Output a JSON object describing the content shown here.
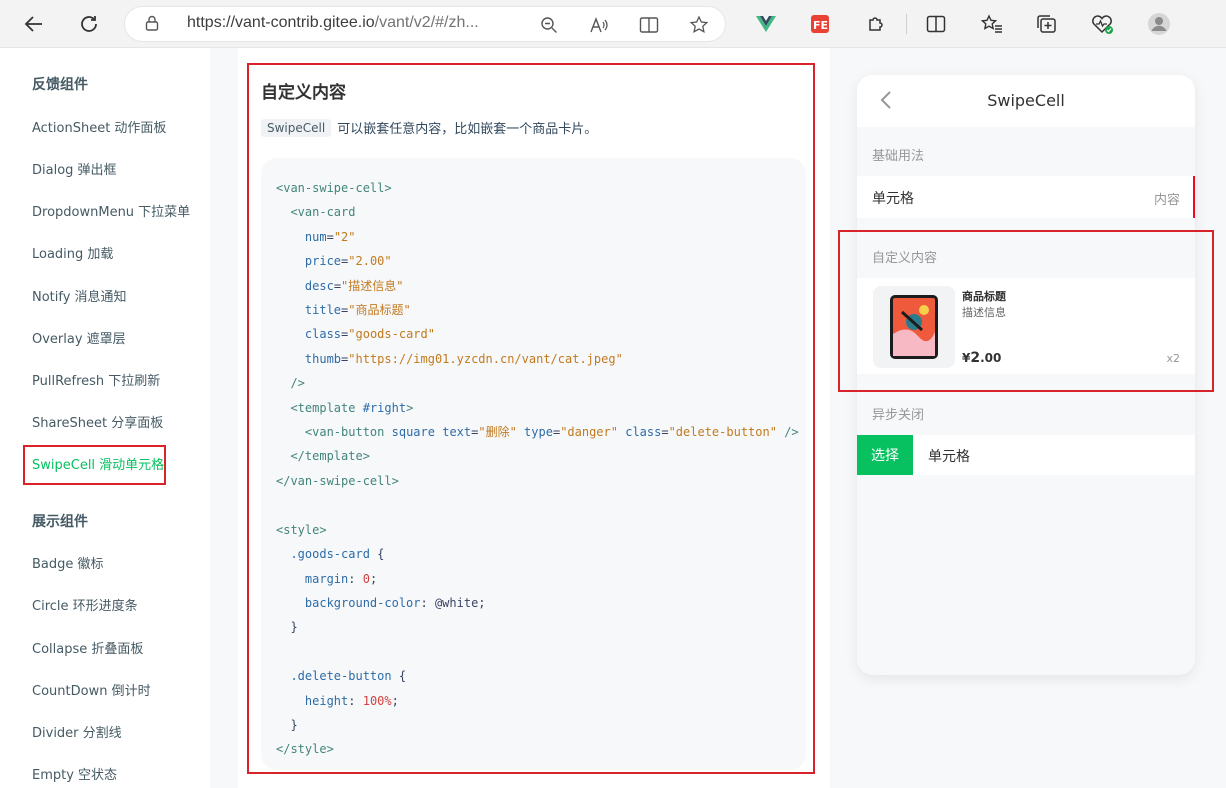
{
  "browser": {
    "url_host": "https://vant-contrib.gitee.io",
    "url_path": "/vant/v2/#/zh..."
  },
  "sidebar": {
    "groups": [
      {
        "title": "反馈组件",
        "items": [
          "ActionSheet 动作面板",
          "Dialog 弹出框",
          "DropdownMenu 下拉菜单",
          "Loading 加载",
          "Notify 消息通知",
          "Overlay 遮罩层",
          "PullRefresh 下拉刷新",
          "ShareSheet 分享面板",
          "SwipeCell 滑动单元格"
        ]
      },
      {
        "title": "展示组件",
        "items": [
          "Badge 徽标",
          "Circle 环形进度条",
          "Collapse 折叠面板",
          "CountDown 倒计时",
          "Divider 分割线",
          "Empty 空状态"
        ]
      }
    ],
    "active": "SwipeCell 滑动单元格"
  },
  "doc": {
    "title": "自定义内容",
    "desc_code": "SwipeCell",
    "desc_text": "可以嵌套任意内容，比如嵌套一个商品卡片。"
  },
  "phone": {
    "title": "SwipeCell",
    "sections": {
      "basic": "基础用法",
      "custom": "自定义内容",
      "async": "异步关闭"
    },
    "basic_cell": {
      "title": "单元格",
      "value": "内容"
    },
    "goods": {
      "title": "商品标题",
      "desc": "描述信息",
      "currency": "¥",
      "price_int": "2",
      "price_dec": ".00",
      "num": "x2"
    },
    "async_cell": {
      "button": "选择",
      "title": "单元格"
    }
  },
  "colors": {
    "accent": "#07c160",
    "highlight": "#d9232a",
    "danger": "#ee0a24"
  }
}
